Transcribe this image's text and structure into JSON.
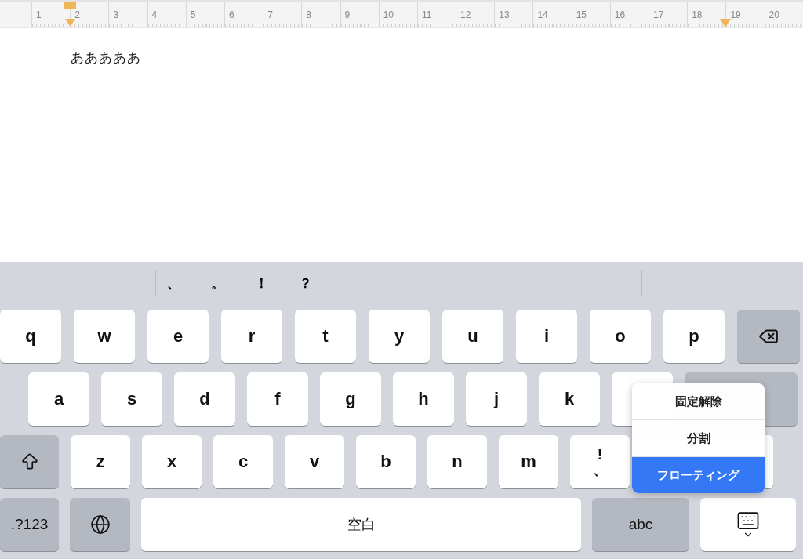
{
  "ruler": {
    "numbers": [
      "1",
      "2",
      "3",
      "4",
      "5",
      "6",
      "7",
      "8",
      "9",
      "10",
      "11",
      "12",
      "13",
      "14",
      "15",
      "16",
      "17",
      "18",
      "19",
      "20"
    ]
  },
  "document": {
    "text": "あああああ"
  },
  "keyboard": {
    "candidates": [
      "、",
      "。",
      "！",
      "？"
    ],
    "rows": [
      [
        {
          "kind": "letter",
          "label": "q"
        },
        {
          "kind": "letter",
          "label": "w"
        },
        {
          "kind": "letter",
          "label": "e"
        },
        {
          "kind": "letter",
          "label": "r"
        },
        {
          "kind": "letter",
          "label": "t"
        },
        {
          "kind": "letter",
          "label": "y"
        },
        {
          "kind": "letter",
          "label": "u"
        },
        {
          "kind": "letter",
          "label": "i"
        },
        {
          "kind": "letter",
          "label": "o"
        },
        {
          "kind": "letter",
          "label": "p"
        },
        {
          "kind": "delete"
        }
      ],
      [
        {
          "kind": "letter",
          "label": "a"
        },
        {
          "kind": "letter",
          "label": "s"
        },
        {
          "kind": "letter",
          "label": "d"
        },
        {
          "kind": "letter",
          "label": "f"
        },
        {
          "kind": "letter",
          "label": "g"
        },
        {
          "kind": "letter",
          "label": "h"
        },
        {
          "kind": "letter",
          "label": "j"
        },
        {
          "kind": "letter",
          "label": "k"
        },
        {
          "kind": "letter"
        },
        {
          "kind": "return"
        }
      ],
      [
        {
          "kind": "shift"
        },
        {
          "kind": "letter",
          "label": "z"
        },
        {
          "kind": "letter",
          "label": "x"
        },
        {
          "kind": "letter",
          "label": "c"
        },
        {
          "kind": "letter",
          "label": "v"
        },
        {
          "kind": "letter",
          "label": "b"
        },
        {
          "kind": "letter",
          "label": "n"
        },
        {
          "kind": "letter",
          "label": "m"
        },
        {
          "kind": "punct",
          "top": "!",
          "bottom": "、"
        },
        {
          "kind": "wide"
        }
      ],
      [
        {
          "kind": "mode",
          "label": ".?123"
        },
        {
          "kind": "globe"
        },
        {
          "kind": "space",
          "label": "空白"
        },
        {
          "kind": "abc",
          "label": "abc"
        },
        {
          "kind": "dismiss"
        }
      ]
    ],
    "menu": [
      {
        "label": "固定解除",
        "selected": false
      },
      {
        "label": "分割",
        "selected": false
      },
      {
        "label": "フローティング",
        "selected": true
      }
    ]
  }
}
